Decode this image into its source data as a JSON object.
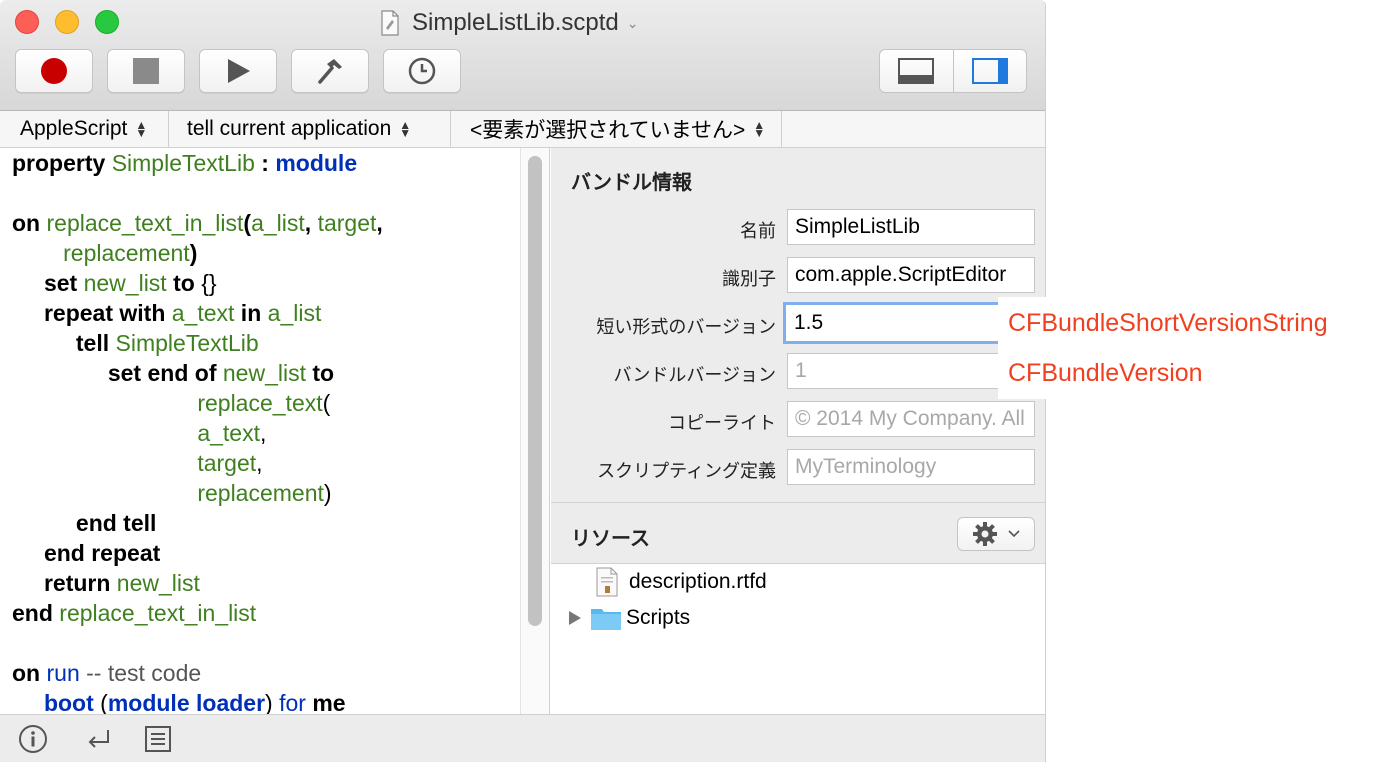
{
  "window": {
    "title": "SimpleListLib.scptd"
  },
  "toolbar": {
    "record": "record",
    "stop": "stop",
    "run": "run",
    "compile": "compile",
    "log": "log"
  },
  "navbar": {
    "language": "AppleScript",
    "target": "tell current application",
    "element": "<要素が選択されていません>"
  },
  "code": {
    "lines": [
      [
        [
          "kw",
          "property "
        ],
        [
          "var",
          "SimpleTextLib"
        ],
        [
          "kw",
          " : "
        ],
        [
          "app",
          "module"
        ]
      ],
      [],
      [
        [
          "kw",
          "on "
        ],
        [
          "var",
          "replace_text_in_list"
        ],
        [
          "kw",
          "("
        ],
        [
          "var",
          "a_list"
        ],
        [
          "kw",
          ", "
        ],
        [
          "var",
          "target"
        ],
        [
          "kw",
          ","
        ]
      ],
      [
        [
          "kw",
          "        "
        ],
        [
          "var",
          "replacement"
        ],
        [
          "kw",
          ")"
        ]
      ],
      [
        [
          "kw",
          "     set "
        ],
        [
          "var",
          "new_list"
        ],
        [
          "kw",
          " to "
        ],
        [
          "plain",
          "{}"
        ]
      ],
      [
        [
          "kw",
          "     repeat with "
        ],
        [
          "var",
          "a_text"
        ],
        [
          "kw",
          " in "
        ],
        [
          "var",
          "a_list"
        ]
      ],
      [
        [
          "kw",
          "          tell "
        ],
        [
          "var",
          "SimpleTextLib"
        ]
      ],
      [
        [
          "kw",
          "               set end of "
        ],
        [
          "var",
          "new_list"
        ],
        [
          "kw",
          " to"
        ]
      ],
      [
        [
          "plain",
          "                             "
        ],
        [
          "var",
          "replace_text"
        ],
        [
          "plain",
          "("
        ]
      ],
      [
        [
          "plain",
          "                             "
        ],
        [
          "var",
          "a_text"
        ],
        [
          "plain",
          ","
        ]
      ],
      [
        [
          "plain",
          "                             "
        ],
        [
          "var",
          "target"
        ],
        [
          "plain",
          ","
        ]
      ],
      [
        [
          "plain",
          "                             "
        ],
        [
          "var",
          "replacement"
        ],
        [
          "plain",
          ")"
        ]
      ],
      [
        [
          "kw",
          "          end tell"
        ]
      ],
      [
        [
          "kw",
          "     end repeat"
        ]
      ],
      [
        [
          "kw",
          "     return "
        ],
        [
          "var",
          "new_list"
        ]
      ],
      [
        [
          "kw",
          "end "
        ],
        [
          "var",
          "replace_text_in_list"
        ]
      ],
      [],
      [
        [
          "kw",
          "on "
        ],
        [
          "cmd",
          "run"
        ],
        [
          "cmt",
          " -- test code"
        ]
      ],
      [
        [
          "kw",
          "     "
        ],
        [
          "app",
          "boot"
        ],
        [
          "plain",
          " ("
        ],
        [
          "app",
          "module loader"
        ],
        [
          "plain",
          ") "
        ],
        [
          "cmd",
          "for"
        ],
        [
          "kw",
          " me"
        ]
      ]
    ]
  },
  "bundle": {
    "header": "バンドル情報",
    "name_label": "名前",
    "name_value": "SimpleListLib",
    "identifier_label": "識別子",
    "identifier_value": "com.apple.ScriptEditor",
    "short_version_label": "短い形式のバージョン",
    "short_version_value": "1.5",
    "bundle_version_label": "バンドルバージョン",
    "bundle_version_value": "1",
    "copyright_label": "コピーライト",
    "copyright_value": "© 2014 My Company. All",
    "terminology_label": "スクリプティング定義",
    "terminology_value": "MyTerminology"
  },
  "resources": {
    "header": "リソース",
    "items": [
      {
        "name": "description.rtfd"
      },
      {
        "name": "Scripts"
      }
    ]
  },
  "callouts": {
    "short_version_key": "CFBundleShortVersionString",
    "bundle_version_key": "CFBundleVersion"
  },
  "colors": {
    "record": "#c80000",
    "keyword": "#000000",
    "variable": "#3f7f1f",
    "application": "#0030b8",
    "focus_ring": "#7fb0ea",
    "callout_text": "#f0401f",
    "folder": "#5ab8f0",
    "segment_active": "#1f7ae0"
  }
}
